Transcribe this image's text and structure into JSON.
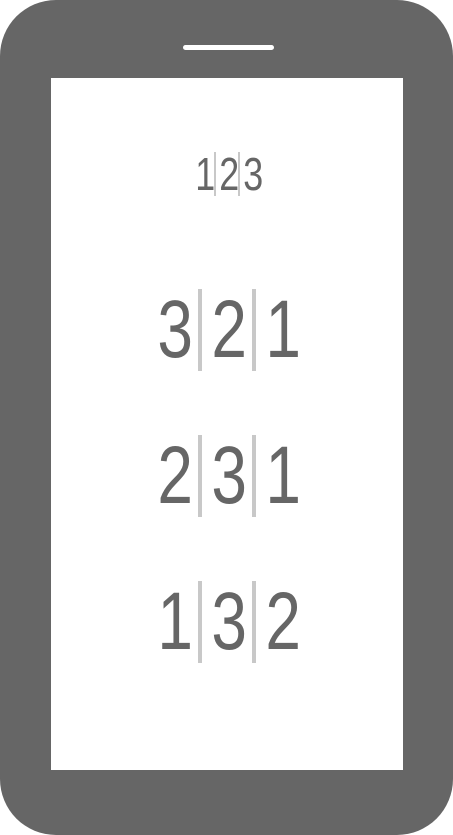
{
  "puzzle": {
    "target": [
      "1",
      "2",
      "3"
    ],
    "options": [
      [
        "3",
        "2",
        "1"
      ],
      [
        "2",
        "3",
        "1"
      ],
      [
        "1",
        "3",
        "2"
      ]
    ]
  }
}
